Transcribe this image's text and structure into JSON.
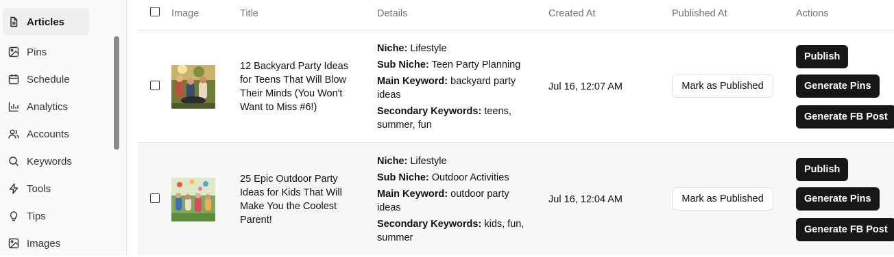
{
  "sidebar": {
    "items": [
      {
        "label": "Articles",
        "icon": "file-text-icon",
        "active": true
      },
      {
        "label": "Pins",
        "icon": "image-icon"
      },
      {
        "label": "Schedule",
        "icon": "calendar-icon"
      },
      {
        "label": "Analytics",
        "icon": "bar-chart-icon"
      },
      {
        "label": "Accounts",
        "icon": "users-icon"
      },
      {
        "label": "Keywords",
        "icon": "search-icon"
      },
      {
        "label": "Tools",
        "icon": "zap-icon"
      },
      {
        "label": "Tips",
        "icon": "lightbulb-icon"
      },
      {
        "label": "Images",
        "icon": "image-icon"
      }
    ]
  },
  "table": {
    "headers": {
      "image": "Image",
      "title": "Title",
      "details": "Details",
      "created": "Created At",
      "published": "Published At",
      "actions": "Actions"
    },
    "labels": {
      "niche": "Niche:",
      "sub_niche": "Sub Niche:",
      "main_keyword": "Main Keyword:",
      "secondary_keywords": "Secondary Keywords:"
    },
    "rows": [
      {
        "title": "12 Backyard Party Ideas for Teens That Will Blow Their Minds (You Won't Want to Miss #6!)",
        "niche": "Lifestyle",
        "sub_niche": "Teen Party Planning",
        "main_keyword": "backyard party ideas",
        "secondary_keywords": "teens, summer, fun",
        "created_at": "Jul 16, 12:07 AM",
        "mark_published": "Mark as Published",
        "publish": "Publish",
        "generate_pins": "Generate Pins",
        "generate_fb": "Generate FB Post"
      },
      {
        "title": "25 Epic Outdoor Party Ideas for Kids That Will Make You the Coolest Parent!",
        "niche": "Lifestyle",
        "sub_niche": "Outdoor Activities",
        "main_keyword": "outdoor party ideas",
        "secondary_keywords": "kids, fun, summer",
        "created_at": "Jul 16, 12:04 AM",
        "mark_published": "Mark as Published",
        "publish": "Publish",
        "generate_pins": "Generate Pins",
        "generate_fb": "Generate FB Post"
      }
    ]
  },
  "colors": {
    "button_dark": "#171717",
    "active_bg": "#efefef",
    "muted_text": "#737373"
  }
}
